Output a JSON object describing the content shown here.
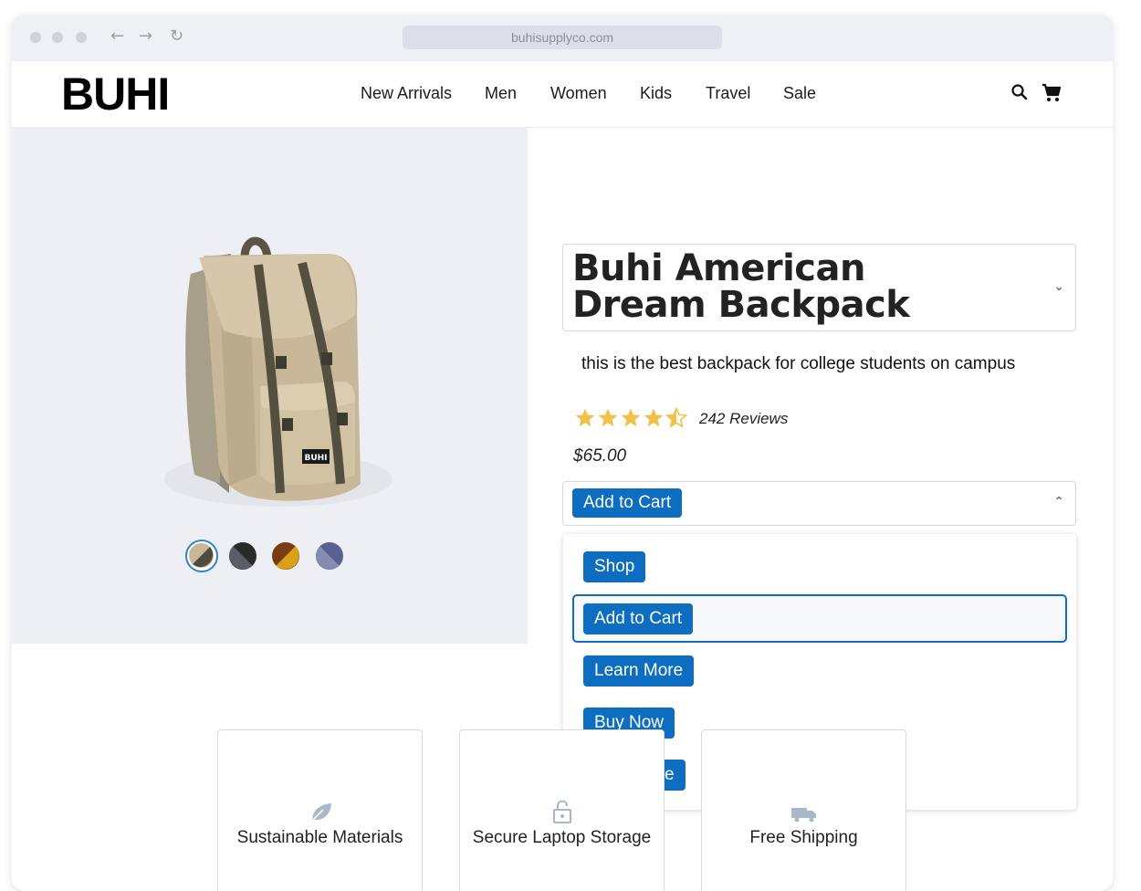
{
  "browser": {
    "url": "buhisupplyco.com"
  },
  "header": {
    "logo": "BUHI",
    "nav": [
      "New Arrivals",
      "Men",
      "Women",
      "Kids",
      "Travel",
      "Sale"
    ],
    "icons": [
      "search-icon",
      "cart-icon"
    ]
  },
  "product": {
    "title": "Buhi American Dream Backpack",
    "description": "this is the best backpack for college students on campus",
    "rating": 4.5,
    "rating_max": 5,
    "reviews": "242 Reviews",
    "price": "$65.00",
    "swatches": [
      {
        "a": "#c9b79a",
        "b": "#4f4b3f"
      },
      {
        "a": "#555555",
        "b": "#2a2a2a"
      },
      {
        "a": "#d9a216",
        "b": "#7a3d12"
      },
      {
        "a": "#7f86ad",
        "b": "#5a6190"
      }
    ],
    "selected_swatch": 0
  },
  "cta": {
    "selected": "Add to Cart",
    "options": [
      "Shop",
      "Add to Cart",
      "Learn More",
      "Buy Now",
      "Click Here"
    ],
    "highlighted_index": 1
  },
  "features": [
    {
      "label": "Sustainable Materials",
      "icon": "leaf-icon"
    },
    {
      "label": "Secure Laptop Storage",
      "icon": "lock-icon"
    },
    {
      "label": "Free Shipping",
      "icon": "truck-icon"
    }
  ],
  "colors": {
    "accent": "#0d6dc0",
    "star": "#f1c24a",
    "hero_bg": "#eeeff4"
  }
}
